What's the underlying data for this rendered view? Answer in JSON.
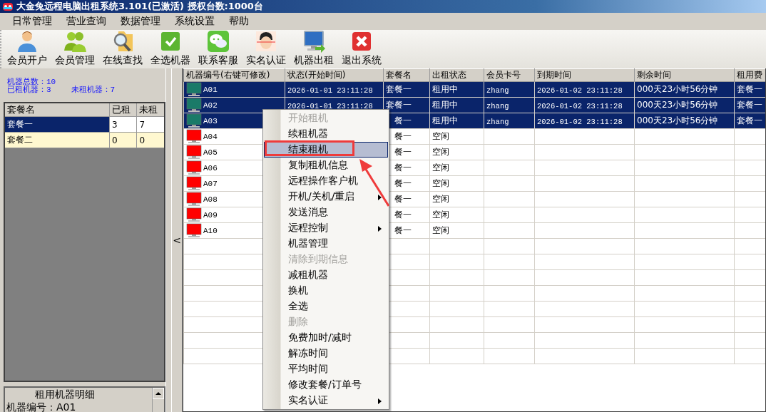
{
  "window": {
    "title": "大金兔远程电脑出租系统3.101(已激活) 授权台数:1000台"
  },
  "menu_bar": [
    "日常管理",
    "营业查询",
    "数据管理",
    "系统设置",
    "帮助"
  ],
  "toolbar": [
    {
      "label": "会员开户",
      "kind": "person"
    },
    {
      "label": "会员管理",
      "kind": "people"
    },
    {
      "label": "在线查找",
      "kind": "search"
    },
    {
      "label": "全选机器",
      "kind": "check"
    },
    {
      "label": "联系客服",
      "kind": "chat"
    },
    {
      "label": "实名认证",
      "kind": "face"
    },
    {
      "label": "机器出租",
      "kind": "monitor"
    },
    {
      "label": "退出系统",
      "kind": "exit"
    }
  ],
  "summary": {
    "total": "机器总数：10",
    "rented": "已租机器：3",
    "idle": "未租机器：7"
  },
  "packages": {
    "columns": [
      "套餐名",
      "已租",
      "未租"
    ],
    "rows": [
      {
        "cells": [
          "套餐一",
          "3",
          "7"
        ],
        "selected": true
      },
      {
        "cells": [
          "套餐二",
          "0",
          "0"
        ],
        "selected": false
      }
    ]
  },
  "detail_panel": {
    "title": "租用机器明细",
    "lines": [
      "机器编号：A01"
    ]
  },
  "splitter": {
    "label": "<"
  },
  "machines": {
    "columns": [
      "机器编号(右键可修改)",
      "状态(开始时间)",
      "套餐名",
      "出租状态",
      "会员卡号",
      "到期时间",
      "剩余时间",
      "租用费"
    ],
    "rows": [
      {
        "cells": [
          "A01",
          "2026-01-01 23:11:28",
          "套餐一",
          "租用中",
          "zhang",
          "2026-01-02 23:11:28",
          "000天23小时56分钟",
          "套餐一"
        ],
        "selected": true,
        "color": "#1a7a68"
      },
      {
        "cells": [
          "A02",
          "2026-01-01 23:11:28",
          "套餐一",
          "租用中",
          "zhang",
          "2026-01-02 23:11:28",
          "000天23小时56分钟",
          "套餐一"
        ],
        "selected": true,
        "color": "#1a7a68"
      },
      {
        "cells": [
          "A03",
          "",
          "餐一",
          "租用中",
          "zhang",
          "2026-01-02 23:11:28",
          "000天23小时56分钟",
          "套餐一"
        ],
        "selected": true,
        "color": "#1a7a68"
      },
      {
        "cells": [
          "A04",
          "",
          "餐一",
          "空闲",
          "",
          "",
          "",
          ""
        ],
        "selected": false,
        "color": "#ff0000"
      },
      {
        "cells": [
          "A05",
          "",
          "餐一",
          "空闲",
          "",
          "",
          "",
          ""
        ],
        "selected": false,
        "color": "#ff0000"
      },
      {
        "cells": [
          "A06",
          "",
          "餐一",
          "空闲",
          "",
          "",
          "",
          ""
        ],
        "selected": false,
        "color": "#ff0000"
      },
      {
        "cells": [
          "A07",
          "",
          "餐一",
          "空闲",
          "",
          "",
          "",
          ""
        ],
        "selected": false,
        "color": "#ff0000"
      },
      {
        "cells": [
          "A08",
          "",
          "餐一",
          "空闲",
          "",
          "",
          "",
          ""
        ],
        "selected": false,
        "color": "#ff0000"
      },
      {
        "cells": [
          "A09",
          "",
          "餐一",
          "空闲",
          "",
          "",
          "",
          ""
        ],
        "selected": false,
        "color": "#ff0000"
      },
      {
        "cells": [
          "A10",
          "",
          "餐一",
          "空闲",
          "",
          "",
          "",
          ""
        ],
        "selected": false,
        "color": "#ff0000"
      }
    ]
  },
  "context_menu": [
    {
      "label": "开始租机",
      "disabled": true,
      "highlighted": false,
      "submenu": false,
      "marked": false
    },
    {
      "label": "续租机器",
      "disabled": false,
      "highlighted": false,
      "submenu": false,
      "marked": false
    },
    {
      "label": "结束租机",
      "disabled": false,
      "highlighted": true,
      "submenu": false,
      "marked": true
    },
    {
      "label": "复制租机信息",
      "disabled": false,
      "highlighted": false,
      "submenu": false,
      "marked": false
    },
    {
      "label": "远程操作客户机",
      "disabled": false,
      "highlighted": false,
      "submenu": false,
      "marked": false
    },
    {
      "label": "开机/关机/重启",
      "disabled": false,
      "highlighted": false,
      "submenu": true,
      "marked": false
    },
    {
      "label": "发送消息",
      "disabled": false,
      "highlighted": false,
      "submenu": false,
      "marked": false
    },
    {
      "label": "远程控制",
      "disabled": false,
      "highlighted": false,
      "submenu": true,
      "marked": false
    },
    {
      "label": "机器管理",
      "disabled": false,
      "highlighted": false,
      "submenu": false,
      "marked": false
    },
    {
      "label": "清除到期信息",
      "disabled": true,
      "highlighted": false,
      "submenu": false,
      "marked": false
    },
    {
      "label": "减租机器",
      "disabled": false,
      "highlighted": false,
      "submenu": false,
      "marked": false
    },
    {
      "label": "换机",
      "disabled": false,
      "highlighted": false,
      "submenu": false,
      "marked": false
    },
    {
      "label": "全选",
      "disabled": false,
      "highlighted": false,
      "submenu": false,
      "marked": false
    },
    {
      "label": "删除",
      "disabled": true,
      "highlighted": false,
      "submenu": false,
      "marked": false
    },
    {
      "label": "免费加时/减时",
      "disabled": false,
      "highlighted": false,
      "submenu": false,
      "marked": false
    },
    {
      "label": "解冻时间",
      "disabled": false,
      "highlighted": false,
      "submenu": false,
      "marked": false
    },
    {
      "label": "平均时间",
      "disabled": false,
      "highlighted": false,
      "submenu": false,
      "marked": false
    },
    {
      "label": "修改套餐/订单号",
      "disabled": false,
      "highlighted": false,
      "submenu": false,
      "marked": false
    },
    {
      "label": "实名认证",
      "disabled": false,
      "highlighted": false,
      "submenu": true,
      "marked": false
    }
  ]
}
